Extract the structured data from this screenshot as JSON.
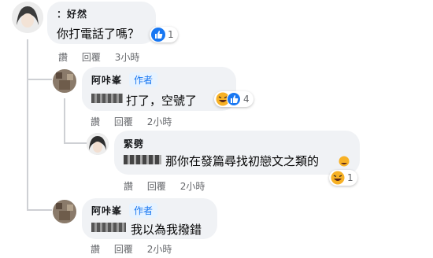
{
  "comments": [
    {
      "name": "：好然",
      "text": "你打電話了嗎？",
      "reaction_count": "1",
      "actions": {
        "like": "讚",
        "reply": "回覆",
        "time": "3小時"
      }
    },
    {
      "name": "阿咔峯",
      "author_badge": "作者",
      "text": "打了，空號了",
      "reaction_count": "4",
      "actions": {
        "like": "讚",
        "reply": "回覆",
        "time": "2小時"
      }
    },
    {
      "name": "緊劈",
      "text": "那你在發篇尋找初戀文之類的",
      "reaction_count": "1",
      "actions": {
        "like": "讚",
        "reply": "回覆",
        "time": "2小時"
      }
    },
    {
      "name": "阿咔峯",
      "author_badge": "作者",
      "text": "我以為我撥錯",
      "actions": {
        "like": "讚",
        "reply": "回覆",
        "time": "2小時"
      }
    }
  ],
  "colors": {
    "like_blue": "#1877f2",
    "haha_yellow": "#f7b125",
    "bubble": "#f0f2f5",
    "meta": "#65676b"
  },
  "icons": {
    "like": "thumbs-up-icon",
    "haha": "laughing-face-icon"
  }
}
